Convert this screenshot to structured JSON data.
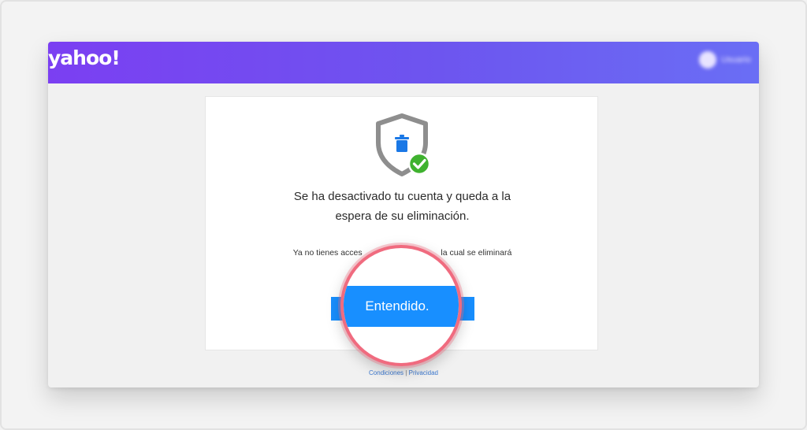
{
  "header": {
    "logo_text": "yahoo!",
    "profile_name": "Usuario"
  },
  "card": {
    "icon": "shield-trash-check-icon",
    "heading_line1": "Se ha desactivado tu cuenta y queda a la",
    "heading_line2": "espera de su eliminación.",
    "note_left": "Ya no tienes acces",
    "note_right": "la cual se eliminará",
    "button_label": "Entendido."
  },
  "footer": {
    "terms_label": "Condiciones",
    "separator": "|",
    "privacy_label": "Privacidad"
  },
  "colors": {
    "header_start": "#7b3ff2",
    "header_end": "#6a6ef5",
    "button": "#188fff",
    "magnifier_ring": "#f06b7f",
    "check_badge": "#3fb22f",
    "shield": "#8e8e8e"
  }
}
